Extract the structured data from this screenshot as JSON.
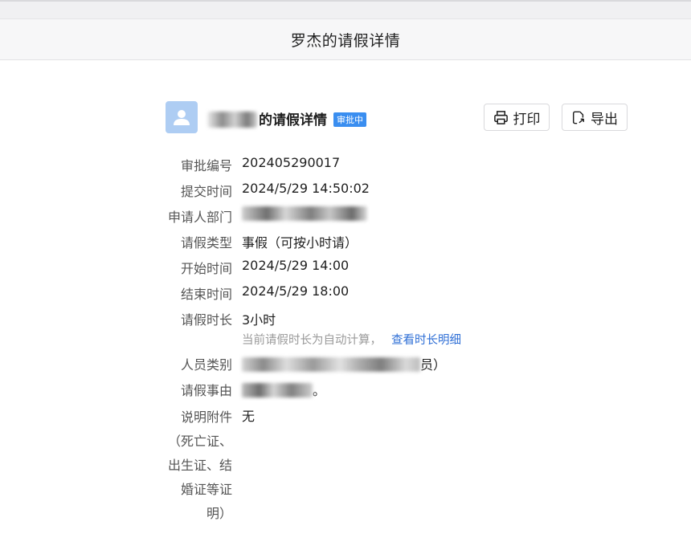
{
  "window": {
    "title": "罗杰的请假详情"
  },
  "header": {
    "doc_title": "的请假详情",
    "status_badge": "审批中",
    "print_label": "打印",
    "export_label": "导出"
  },
  "fields": {
    "approval_no": {
      "label": "审批编号",
      "value": "202405290017"
    },
    "submit_time": {
      "label": "提交时间",
      "value": "2024/5/29 14:50:02"
    },
    "department": {
      "label": "申请人部门"
    },
    "leave_type": {
      "label": "请假类型",
      "value": "事假（可按小时请）"
    },
    "start_time": {
      "label": "开始时间",
      "value": "2024/5/29 14:00"
    },
    "end_time": {
      "label": "结束时间",
      "value": "2024/5/29 18:00"
    },
    "duration": {
      "label": "请假时长",
      "value": "3小时",
      "hint": "当前请假时长为自动计算，",
      "link": "查看时长明细"
    },
    "staff_type": {
      "label": "人员类别",
      "tail": "员）"
    },
    "reason": {
      "label": "请假事由",
      "tail": "。"
    },
    "attachment": {
      "label_lines": [
        "说明附件",
        "（死亡证、",
        "出生证、结",
        "婚证等证",
        "明）"
      ],
      "value": "无"
    }
  },
  "colors": {
    "badge": "#3a8ef0",
    "link": "#2f6fd6",
    "avatar": "#aecdf3"
  }
}
